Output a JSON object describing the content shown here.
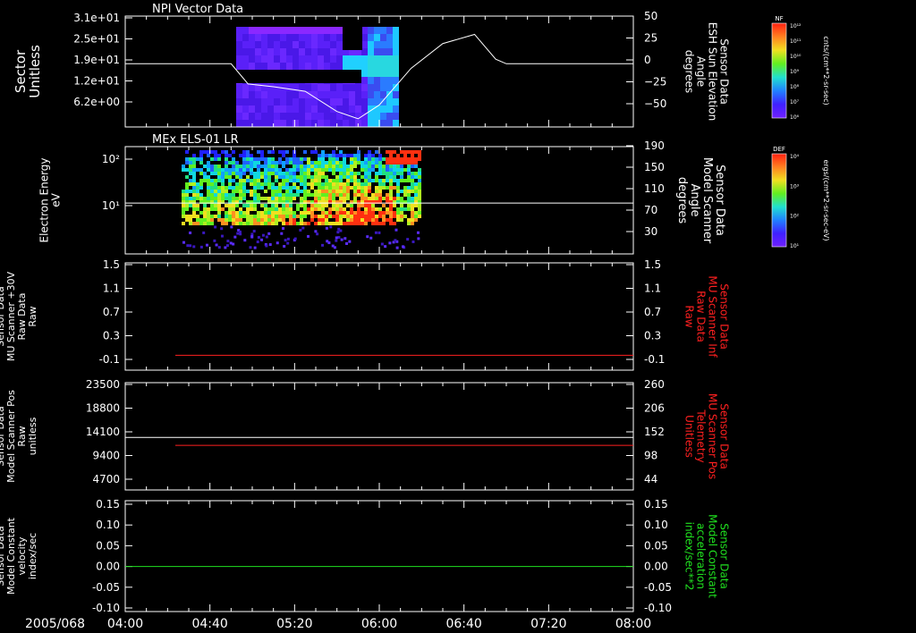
{
  "title_top": "NPI Vector Data",
  "date_label": "2005/068",
  "x_ticks": [
    "04:00",
    "04:40",
    "05:20",
    "06:00",
    "06:40",
    "07:20",
    "08:00"
  ],
  "colors": {
    "white": "#ffffff",
    "red": "#ff2020",
    "green": "#20e020"
  },
  "panels": [
    {
      "id": "npi",
      "title": "NPI Vector Data",
      "left_label": [
        "Sector",
        "Unitless"
      ],
      "left_ticks": [
        "3.1e+01",
        "2.5e+01",
        "1.9e+01",
        "1.2e+01",
        "6.2e+00"
      ],
      "right_label": [
        "Sensor Data",
        "ESH Sun Elevation",
        "Angle",
        "degrees"
      ],
      "right_ticks": [
        "50",
        "25",
        "0",
        "−25",
        "−50"
      ]
    },
    {
      "id": "els",
      "title": "MEx ELS-01 LR",
      "left_label": [
        "Electron Energy",
        "eV"
      ],
      "left_ticks": [
        "10²",
        "10¹"
      ],
      "right_label": [
        "Sensor Data",
        "Model Scanner",
        "Angle",
        "degrees"
      ],
      "right_ticks": [
        "190",
        "150",
        "110",
        "70",
        "30"
      ]
    },
    {
      "id": "mu_raw",
      "left_label": [
        "Sensor Data",
        "MU Scanner +30V",
        "Raw Data",
        "Raw"
      ],
      "left_ticks": [
        "1.5",
        "1.1",
        "0.7",
        "0.3",
        "-0.1"
      ],
      "right_label": [
        "Sensor Data",
        "MU Scanner Inf",
        "Raw Data",
        "Raw"
      ],
      "right_ticks": [
        "1.5",
        "1.1",
        "0.7",
        "0.3",
        "-0.1"
      ]
    },
    {
      "id": "scan_pos",
      "left_label": [
        "Sensor Data",
        "Model Scanner Pos",
        "Raw",
        "unitless"
      ],
      "left_ticks": [
        "23500",
        "18800",
        "14100",
        "9400",
        "4700"
      ],
      "right_label": [
        "Sensor Data",
        "MU Scanner Pos",
        "Telemetry",
        "Unitless"
      ],
      "right_ticks": [
        "260",
        "206",
        "152",
        "98",
        "44"
      ]
    },
    {
      "id": "velocity",
      "left_label": [
        "Sensor Data",
        "Model Constant",
        "velocity",
        "index/sec"
      ],
      "left_ticks": [
        "0.15",
        "0.10",
        "0.05",
        "0.00",
        "-0.05",
        "-0.10"
      ],
      "right_label": [
        "Sensor Data",
        "Model Constant",
        "acceleration",
        "index/sec**2"
      ],
      "right_ticks": [
        "0.15",
        "0.10",
        "0.05",
        "0.00",
        "-0.05",
        "-0.10"
      ]
    }
  ],
  "colorbars": [
    {
      "name": "NF",
      "unit": "cnts/(cm**2-sr-sec)",
      "ticks": [
        "10¹²",
        "10¹¹",
        "10¹⁰",
        "10⁹",
        "10⁸",
        "10⁷",
        "10⁶"
      ]
    },
    {
      "name": "DEF",
      "unit": "ergs/(cm**2-sr-sec-eV)",
      "ticks": [
        "10⁴",
        "10³",
        "10²",
        "10¹"
      ]
    }
  ],
  "chart_data": [
    {
      "type": "line",
      "title": "NPI Vector Data",
      "series": [
        {
          "name": "ESH Sun Elevation Angle",
          "unit": "degrees",
          "x": [
            "04:00",
            "04:50",
            "04:58",
            "05:10",
            "05:25",
            "05:40",
            "05:50",
            "06:00",
            "06:15",
            "06:30",
            "06:45",
            "06:55",
            "07:00",
            "08:00"
          ],
          "y": [
            0,
            0,
            -22,
            -25,
            -30,
            -52,
            -60,
            -45,
            -5,
            22,
            32,
            5,
            0,
            0
          ]
        }
      ],
      "ylim": [
        -65,
        50
      ]
    },
    {
      "type": "line",
      "title": "MEx ELS-01 LR",
      "series": [
        {
          "name": "Model Scanner Angle",
          "unit": "degrees",
          "x": [
            "04:00",
            "08:00"
          ],
          "y": [
            90,
            90
          ]
        }
      ],
      "ylim": [
        0,
        190
      ]
    },
    {
      "type": "line",
      "series": [
        {
          "name": "MU Scanner Inf Raw Data",
          "unit": "Raw",
          "x": [
            "04:20",
            "08:00"
          ],
          "y": [
            -0.05,
            -0.05
          ]
        }
      ],
      "ylim": [
        -0.3,
        1.5
      ]
    },
    {
      "type": "line",
      "series": [
        {
          "name": "Model Scanner Pos",
          "unit": "unitless",
          "x": [
            "04:00",
            "08:00"
          ],
          "y": [
            11500,
            11500
          ]
        },
        {
          "name": "MU Scanner Pos Telemetry",
          "unit": "Unitless",
          "x": [
            "04:20",
            "08:00"
          ],
          "y": [
            108,
            108
          ]
        }
      ],
      "ylim_left": [
        0,
        23500
      ],
      "ylim_right": [
        0,
        260
      ]
    },
    {
      "type": "line",
      "series": [
        {
          "name": "Model Constant velocity",
          "unit": "index/sec",
          "x": [
            "04:00",
            "08:00"
          ],
          "y": [
            0,
            0
          ]
        }
      ],
      "ylim": [
        -0.1,
        0.15
      ]
    }
  ]
}
